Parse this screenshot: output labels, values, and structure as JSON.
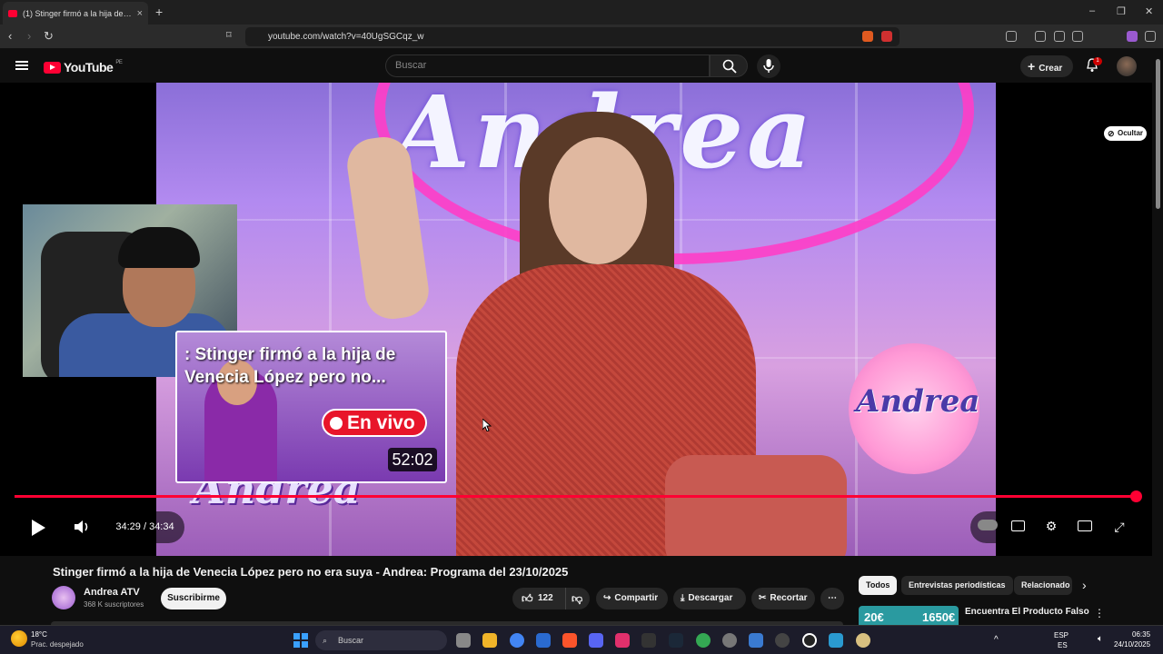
{
  "browser": {
    "tab_title": "(1) Stinger firmó a la hija de Venecia López pero no era suya",
    "url": "youtube.com/watch?v=40UgSGCqz_w",
    "new_tab": "+",
    "tab_close": "×",
    "win_min": "–",
    "win_restore": "❐",
    "win_close": "✕"
  },
  "header": {
    "logo_text": "YouTube",
    "region": "PE",
    "search_placeholder": "Buscar",
    "create_label": "Crear",
    "notif_count": "1"
  },
  "player": {
    "preview_title": ": Stinger firmó a la hija de Venecia López pero no...",
    "preview_live": "En vivo",
    "preview_duration": "52:02",
    "hide_label": "Ocultar",
    "time": "34:29 / 34:34",
    "progress_fraction": 0.998,
    "circle_logo": "Andrea"
  },
  "video": {
    "title": "Stinger firmó a la hija de Venecia López pero no era suya - Andrea: Programa del 23/10/2025",
    "channel": "Andrea ATV",
    "subscribers": "368 K suscriptores",
    "subscribe_label": "Suscribirme",
    "likes": "122",
    "share_label": "Compartir",
    "download_label": "Descargar",
    "clip_label": "Recortar",
    "more_label": "⋯"
  },
  "chips": [
    "Todos",
    "Entrevistas periodísticas",
    "Relacionado"
  ],
  "recommendation": {
    "price1": "20€",
    "price2": "1650€",
    "title": "Encuentra El Producto Falso"
  },
  "taskbar": {
    "temp": "18°C",
    "weather": "Prac. despejado",
    "search_label": "Buscar",
    "lang1": "ESP",
    "lang2": "ES",
    "time": "06:35",
    "date": "24/10/2025"
  },
  "colors": {
    "accent": "#ff0033",
    "background": "#0f0f0f"
  }
}
